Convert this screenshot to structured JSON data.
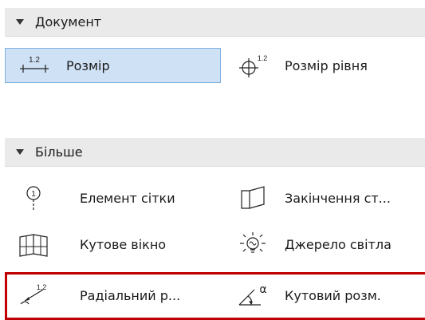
{
  "sections": [
    {
      "title": "Документ",
      "items": [
        {
          "label": "Розмір",
          "icon": "linear-dimension-icon",
          "selected": true
        },
        {
          "label": "Розмір рівня",
          "icon": "level-dimension-icon",
          "selected": false
        }
      ]
    },
    {
      "title": "Більше",
      "items": [
        {
          "label": "Елемент сітки",
          "icon": "grid-element-icon"
        },
        {
          "label": "Закінчення ст...",
          "icon": "wall-end-icon"
        },
        {
          "label": "Кутове вікно",
          "icon": "corner-window-icon"
        },
        {
          "label": "Джерело світла",
          "icon": "light-source-icon"
        },
        {
          "label": "Радіальний р...",
          "icon": "radial-dimension-icon"
        },
        {
          "label": "Кутовий розм.",
          "icon": "angle-dimension-icon"
        }
      ]
    }
  ],
  "icon_text": {
    "dim_value": "1.2",
    "grid_marker": "1",
    "alpha": "α"
  },
  "colors": {
    "highlight_bg": "#cfe1f5",
    "highlight_border": "#7fb1e2",
    "callout_border": "#c00000"
  }
}
